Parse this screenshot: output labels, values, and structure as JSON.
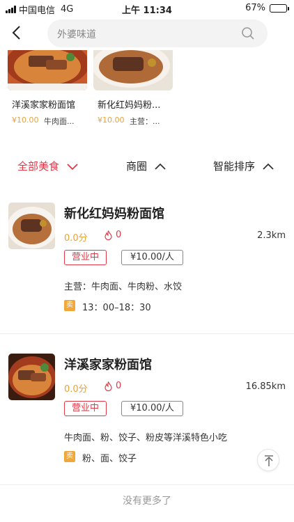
{
  "status_bar": {
    "carrier": "中国电信",
    "network": "4G",
    "time": "上午 11:34",
    "battery": "67%",
    "battery_level": 0.67
  },
  "nav": {
    "search_placeholder": "外婆味道"
  },
  "recommended": [
    {
      "name": "洋溪家家粉面馆",
      "price": "¥10.00",
      "sub": "牛肉面..."
    },
    {
      "name": "新化红妈妈粉...",
      "price": "¥10.00",
      "sub": "主营：..."
    }
  ],
  "filters": {
    "category": "全部美食",
    "area": "商圈",
    "sort": "智能排序"
  },
  "shops": [
    {
      "name": "新化红妈妈粉面馆",
      "score": "0.0分",
      "hot": "0",
      "distance": "2.3km",
      "status": "营业中",
      "price": "¥10.00/人",
      "main": "主营：牛肉面、牛肉粉、水饺",
      "badge": "卖",
      "hours": "13：00–18：30"
    },
    {
      "name": "洋溪家家粉面馆",
      "score": "0.0分",
      "hot": "0",
      "distance": "16.85km",
      "status": "营业中",
      "price": "¥10.00/人",
      "main": "牛肉面、粉、饺子、粉皮等洋溪特色小吃",
      "badge": "卖",
      "hours": "粉、面、饺子"
    }
  ],
  "footer": {
    "no_more": "没有更多了"
  },
  "colors": {
    "accent": "#e03a48",
    "price": "#e8a33b"
  }
}
